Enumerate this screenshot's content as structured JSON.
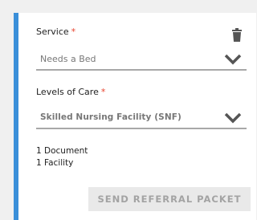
{
  "service": {
    "label": "Service",
    "required_mark": "*",
    "value": "Needs a Bed",
    "delete_icon": "trash-icon",
    "dropdown_icon": "chevron-down-icon"
  },
  "levels_of_care": {
    "label": "Levels of Care",
    "required_mark": "*",
    "value": "Skilled Nursing Facility (SNF)",
    "dropdown_icon": "chevron-down-icon"
  },
  "summary": {
    "documents": "1 Document",
    "facilities": "1 Facility"
  },
  "actions": {
    "send_label": "SEND REFERRAL PACKET"
  },
  "colors": {
    "accent": "#3a8fd9",
    "required": "#e8432e",
    "button_bg": "#e9e9e9",
    "button_text": "#a3a3a3"
  }
}
